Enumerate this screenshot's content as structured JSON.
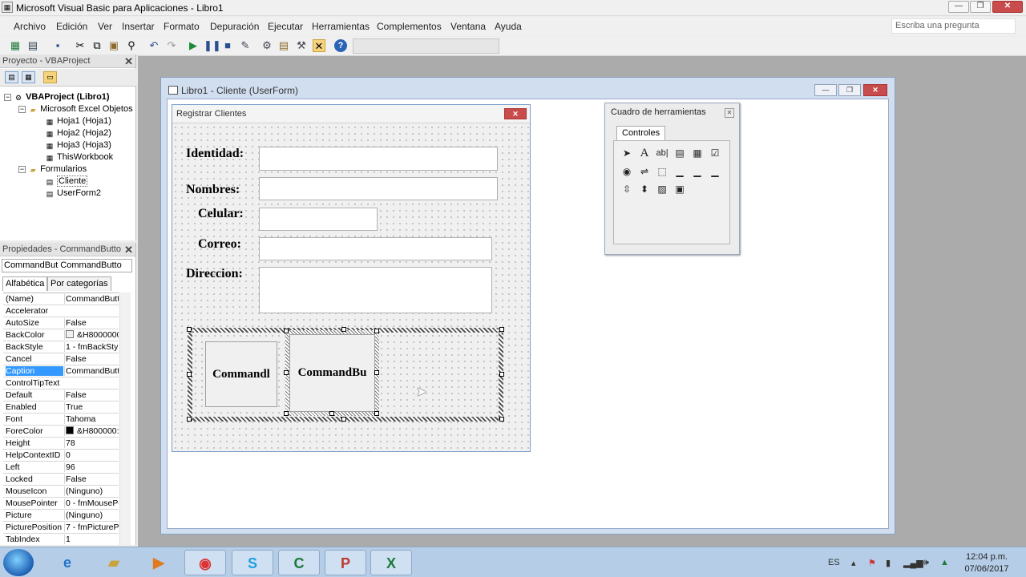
{
  "window": {
    "title": "Microsoft Visual Basic para Aplicaciones - Libro1",
    "min": "—",
    "max": "❐",
    "close": "✕"
  },
  "menubar": {
    "items": [
      "Archivo",
      "Edición",
      "Ver",
      "Insertar",
      "Formato",
      "Depuración",
      "Ejecutar",
      "Herramientas",
      "Complementos",
      "Ventana",
      "Ayuda"
    ],
    "ask_placeholder": "Escriba una pregunta"
  },
  "toolbar": {
    "icons": [
      "excel-icon",
      "insert-userform-icon",
      "save-icon",
      "cut-icon",
      "copy-icon",
      "paste-icon",
      "find-icon",
      "undo-icon",
      "redo-icon",
      "run-icon",
      "break-icon",
      "reset-icon",
      "design-mode-icon",
      "project-explorer-icon",
      "properties-icon",
      "object-browser-icon",
      "toolbox-icon",
      "help-icon"
    ]
  },
  "project": {
    "title": "Proyecto - VBAProject",
    "close": "✕",
    "tree": {
      "root": "VBAProject (Libro1)",
      "excel_folder": "Microsoft Excel Objetos",
      "sheets": [
        "Hoja1 (Hoja1)",
        "Hoja2 (Hoja2)",
        "Hoja3 (Hoja3)",
        "ThisWorkbook"
      ],
      "forms_folder": "Formularios",
      "forms": [
        "Cliente",
        "UserForm2"
      ]
    }
  },
  "properties": {
    "title": "Propiedades - CommandButto",
    "close": "✕",
    "object_select": "CommandBut  CommandButto",
    "tabs": [
      "Alfabética",
      "Por categorías"
    ],
    "rows": [
      {
        "name": "(Name)",
        "value": "CommandButto"
      },
      {
        "name": "Accelerator",
        "value": ""
      },
      {
        "name": "AutoSize",
        "value": "False"
      },
      {
        "name": "BackColor",
        "value": "&H8000000",
        "swatch": "#f0f0f0"
      },
      {
        "name": "BackStyle",
        "value": "1 - fmBackStyle"
      },
      {
        "name": "Cancel",
        "value": "False"
      },
      {
        "name": "Caption",
        "value": "CommandButto",
        "selected": true
      },
      {
        "name": "ControlTipText",
        "value": ""
      },
      {
        "name": "Default",
        "value": "False"
      },
      {
        "name": "Enabled",
        "value": "True"
      },
      {
        "name": "Font",
        "value": "Tahoma"
      },
      {
        "name": "ForeColor",
        "value": "&H800000:",
        "swatch": "#000000"
      },
      {
        "name": "Height",
        "value": "78"
      },
      {
        "name": "HelpContextID",
        "value": "0"
      },
      {
        "name": "Left",
        "value": "96"
      },
      {
        "name": "Locked",
        "value": "False"
      },
      {
        "name": "MouseIcon",
        "value": "(Ninguno)"
      },
      {
        "name": "MousePointer",
        "value": "0 - fmMousePo"
      },
      {
        "name": "Picture",
        "value": "(Ninguno)"
      },
      {
        "name": "PicturePosition",
        "value": "7 - fmPictureP"
      },
      {
        "name": "TabIndex",
        "value": "1"
      }
    ]
  },
  "userform_window": {
    "title": "Libro1 - Cliente (UserForm)"
  },
  "form": {
    "title": "Registrar  Clientes",
    "labels": {
      "identidad": "Identidad:",
      "nombres": "Nombres:",
      "celular": "Celular:",
      "correo": "Correo:",
      "direccion": "Direccion:"
    },
    "buttons": [
      "Commandl",
      "CommandBu"
    ]
  },
  "toolbox": {
    "title": "Cuadro de herramientas",
    "tab": "Controles",
    "tools": [
      "pointer-icon",
      "label-icon",
      "textbox-icon",
      "combobox-icon",
      "listbox-icon",
      "checkbox-icon",
      "optionbutton-icon",
      "togglebutton-icon",
      "frame-icon",
      "commandbutton-icon",
      "tabstrip-icon",
      "multipage-icon",
      "scrollbar-icon",
      "spinbutton-icon",
      "image-icon",
      "refedit-icon"
    ]
  },
  "tray": {
    "language": "ES",
    "time": "12:04 p.m.",
    "date": "07/06/2017"
  },
  "taskbar": {
    "apps": [
      "internet-explorer-icon",
      "file-explorer-icon",
      "media-player-icon",
      "chrome-icon",
      "skype-icon",
      "camtasia-icon",
      "powerpoint-icon",
      "excel-icon"
    ]
  }
}
